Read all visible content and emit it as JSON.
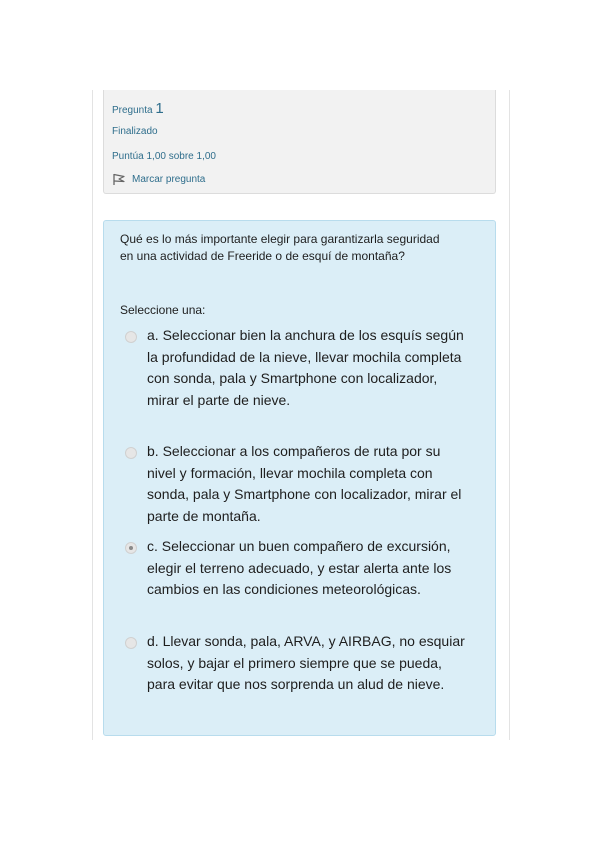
{
  "info": {
    "question_label": "Pregunta",
    "question_number": "1",
    "state": "Finalizado",
    "grade": "Puntúa 1,00 sobre 1,00",
    "flag_label": "Marcar pregunta",
    "flag_icon": "flag-outline-icon"
  },
  "question": {
    "text": "Qué es lo más importante elegir para garantizarla seguridad en una actividad de Freeride o de esquí de montaña?",
    "prompt": "Seleccione una:",
    "answers": [
      {
        "text": "a. Seleccionar bien la anchura de los esquís según la profundidad de la nieve, llevar mochila completa con sonda, pala y Smartphone con localizador, mirar el parte de nieve.",
        "checked": false
      },
      {
        "text": "b. Seleccionar a los compañeros de ruta por su nivel y formación, llevar mochila completa con sonda, pala y Smartphone con localizador, mirar el parte de montaña.",
        "checked": false
      },
      {
        "text": "c. Seleccionar un buen compañero de excursión, elegir el terreno adecuado, y estar alerta ante los cambios en las condiciones meteorológicas.",
        "checked": true
      },
      {
        "text": "d. Llevar sonda, pala, ARVA, y AIRBAG, no esquiar solos, y bajar el primero siempre que se pueda, para evitar que nos sorprenda un alud de nieve.",
        "checked": false
      }
    ]
  },
  "colors": {
    "link": "#2f6e8c",
    "info_bg": "#f2f2f2",
    "question_bg": "#dbeef7",
    "question_border": "#b8dced"
  }
}
